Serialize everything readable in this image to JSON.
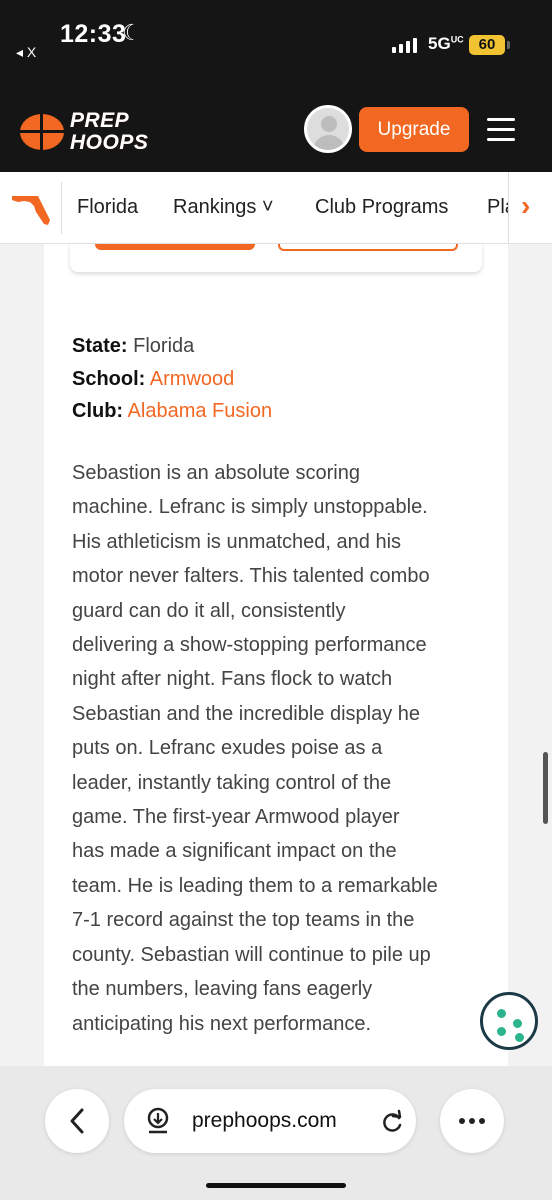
{
  "status_bar": {
    "time": "12:33",
    "back_label": "◂ X",
    "network": "5G",
    "network_suffix": "UC",
    "battery": "60"
  },
  "header": {
    "logo_line1": "PREP",
    "logo_line2": "HOOPS",
    "upgrade_label": "Upgrade"
  },
  "nav": {
    "items": [
      {
        "label": "Florida"
      },
      {
        "label": "Rankings ˅"
      },
      {
        "label": "Club Programs"
      },
      {
        "label": "Pla"
      }
    ]
  },
  "profile": {
    "state_label": "State:",
    "state_value": "Florida",
    "school_label": "School:",
    "school_value": "Armwood",
    "club_label": "Club:",
    "club_value": "Alabama Fusion"
  },
  "bio": {
    "lines": [
      "Sebastion is an absolute scoring",
      "machine. Lefranc is simply unstoppable.",
      "His athleticism is unmatched, and his",
      "motor never falters. This talented combo",
      "guard can do it all, consistently",
      "delivering a show-stopping performance",
      "night after night. Fans flock to watch",
      "Sebastian and the incredible display he",
      "puts on. Lefranc exudes poise as a",
      "leader, instantly taking control of the",
      "game. The first-year Armwood player",
      "has made a significant impact on the",
      "team. He is leading them to a remarkable",
      "7-1 record against the top teams in the",
      "county. Sebastian will continue to pile up",
      "the numbers, leaving fans eagerly",
      "anticipating his next performance."
    ]
  },
  "browser": {
    "url": "prephoops.com"
  },
  "colors": {
    "accent": "#f26722",
    "header_bg": "#151515",
    "cookie_green": "#2ab38c"
  }
}
